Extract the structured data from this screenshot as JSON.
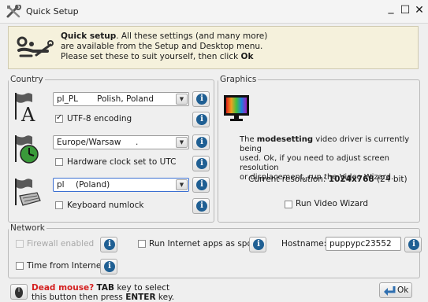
{
  "window": {
    "title": "Quick Setup",
    "minimize_glyph": "_",
    "maximize_glyph": "☐",
    "close_glyph": "✕"
  },
  "banner": {
    "bold": "Quick setup",
    "line1_rest": ". All these settings (and many more)",
    "line2": "are available from the Setup and Desktop menu.",
    "line3_prefix": "Please set these to suit yourself, then click ",
    "line3_bold": "Ok"
  },
  "country": {
    "legend": "Country",
    "locale": {
      "code": "pl_PL",
      "name": "Polish, Poland"
    },
    "utf8_label": "UTF-8 encoding",
    "utf8_checked": true,
    "timezone": "Europe/Warsaw",
    "timezone_suffix": ".",
    "hwclock_label": "Hardware clock set to UTC",
    "hwclock_checked": false,
    "keyboard": {
      "code": "pl",
      "name": "(Poland)"
    },
    "numlock_label": "Keyboard numlock",
    "numlock_checked": false
  },
  "graphics": {
    "legend": "Graphics",
    "desc_prefix": "The ",
    "desc_bold": "modesetting",
    "desc_line1_rest": " video driver is currently being",
    "desc_line2": "used. Ok, if you need to adjust screen resolution",
    "desc_line3": "or displacement, run the Video Wizard.",
    "res_prefix": "Current resolution: ",
    "res_value": "1024x768",
    "res_bits": "(24 bit)",
    "wizard_label": "Run Video Wizard",
    "wizard_checked": false
  },
  "network": {
    "legend": "Network",
    "firewall_label": "Firewall enabled",
    "firewall_enabled": false,
    "spot_label": "Run Internet apps as spot",
    "hostname_label": "Hostname:",
    "hostname_value": "puppypc23552",
    "internet_time_label": "Time from Internet"
  },
  "footer": {
    "warning_red": "Dead mouse?",
    "tab_bold": "TAB",
    "line1_rest": " key to select",
    "line2_prefix": "this button then press ",
    "enter_bold": "ENTER",
    "line2_suffix": " key.",
    "ok_label": "Ok"
  },
  "icons": {
    "title": "tools-icon",
    "banner": "wrench-setup-icon",
    "locale": "flag-letter-icon",
    "timezone": "flag-clock-icon",
    "keyboard": "flag-keyboard-icon",
    "monitor": "monitor-color-icon",
    "info": "info-icon",
    "mouse": "mouse-icon",
    "ok": "ok-arrow-icon"
  },
  "colors": {
    "banner_bg": "#f5f1dc",
    "info_blue": "#1f5f93",
    "warning_red": "#d42020",
    "window_bg": "#efefef"
  }
}
